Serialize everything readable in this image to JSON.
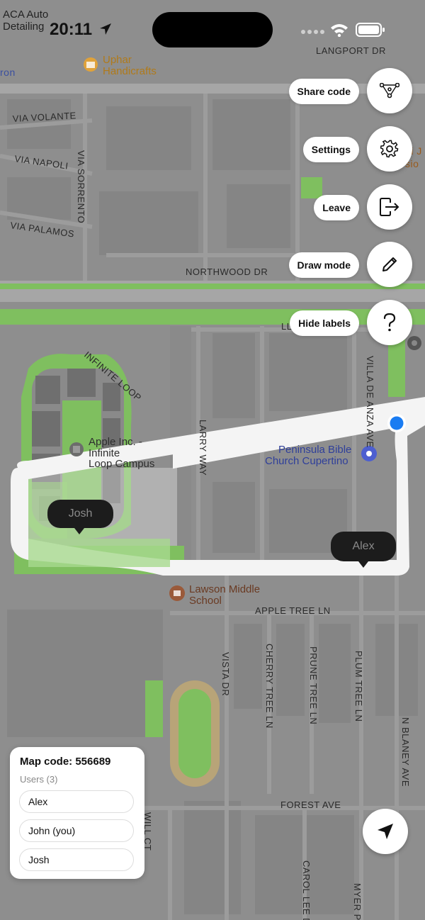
{
  "status_bar": {
    "time": "20:11",
    "carrier_line1": "ACA Auto",
    "carrier_line2": "Detailing"
  },
  "map": {
    "street_labels": [
      "LANGPORT DR",
      "VIA VOLANTE",
      "VIA NAPOLI",
      "VIA SORRENTO",
      "VIA PALAMOS",
      "NORTHWOOD DR",
      "INFINITE LOOP",
      "LARRY WAY",
      "VILLA DE ANZA AVE",
      "APPLE TREE LN",
      "VISTA DR",
      "CHERRY TREE LN",
      "PRUNE TREE LN",
      "PLUM TREE LN",
      "N BLANEY AVE",
      "FOREST AVE",
      "WILL CT",
      "CAROL LEE DR",
      "MYER P",
      "LL",
      "ron",
      "ni J",
      "sio"
    ],
    "poi_labels": {
      "uphar_line1": "Uphar",
      "uphar_line2": "Handicrafts",
      "apple_line1": "Apple Inc. -",
      "apple_line2": "Infinite",
      "apple_line3": "Loop Campus",
      "church_line1": "Peninsula Bible",
      "church_line2": "Church Cupertino",
      "school_line1": "Lawson Middle",
      "school_line2": "School"
    },
    "user_pins": [
      "Josh",
      "Alex"
    ],
    "colors": {
      "green": "#7fbf5f",
      "drawn_path": "#f4f4f4",
      "current_location": "#1a7cf2"
    }
  },
  "actions": [
    {
      "label": "Share code",
      "icon": "share-graph-icon"
    },
    {
      "label": "Settings",
      "icon": "gear-icon"
    },
    {
      "label": "Leave",
      "icon": "exit-icon"
    },
    {
      "label": "Draw mode",
      "icon": "pencil-icon"
    },
    {
      "label": "Hide labels",
      "icon": "question-icon"
    }
  ],
  "panel": {
    "map_code": "Map code: 556689",
    "users_header": "Users (3)",
    "users": [
      "Alex",
      "John (you)",
      "Josh"
    ]
  }
}
